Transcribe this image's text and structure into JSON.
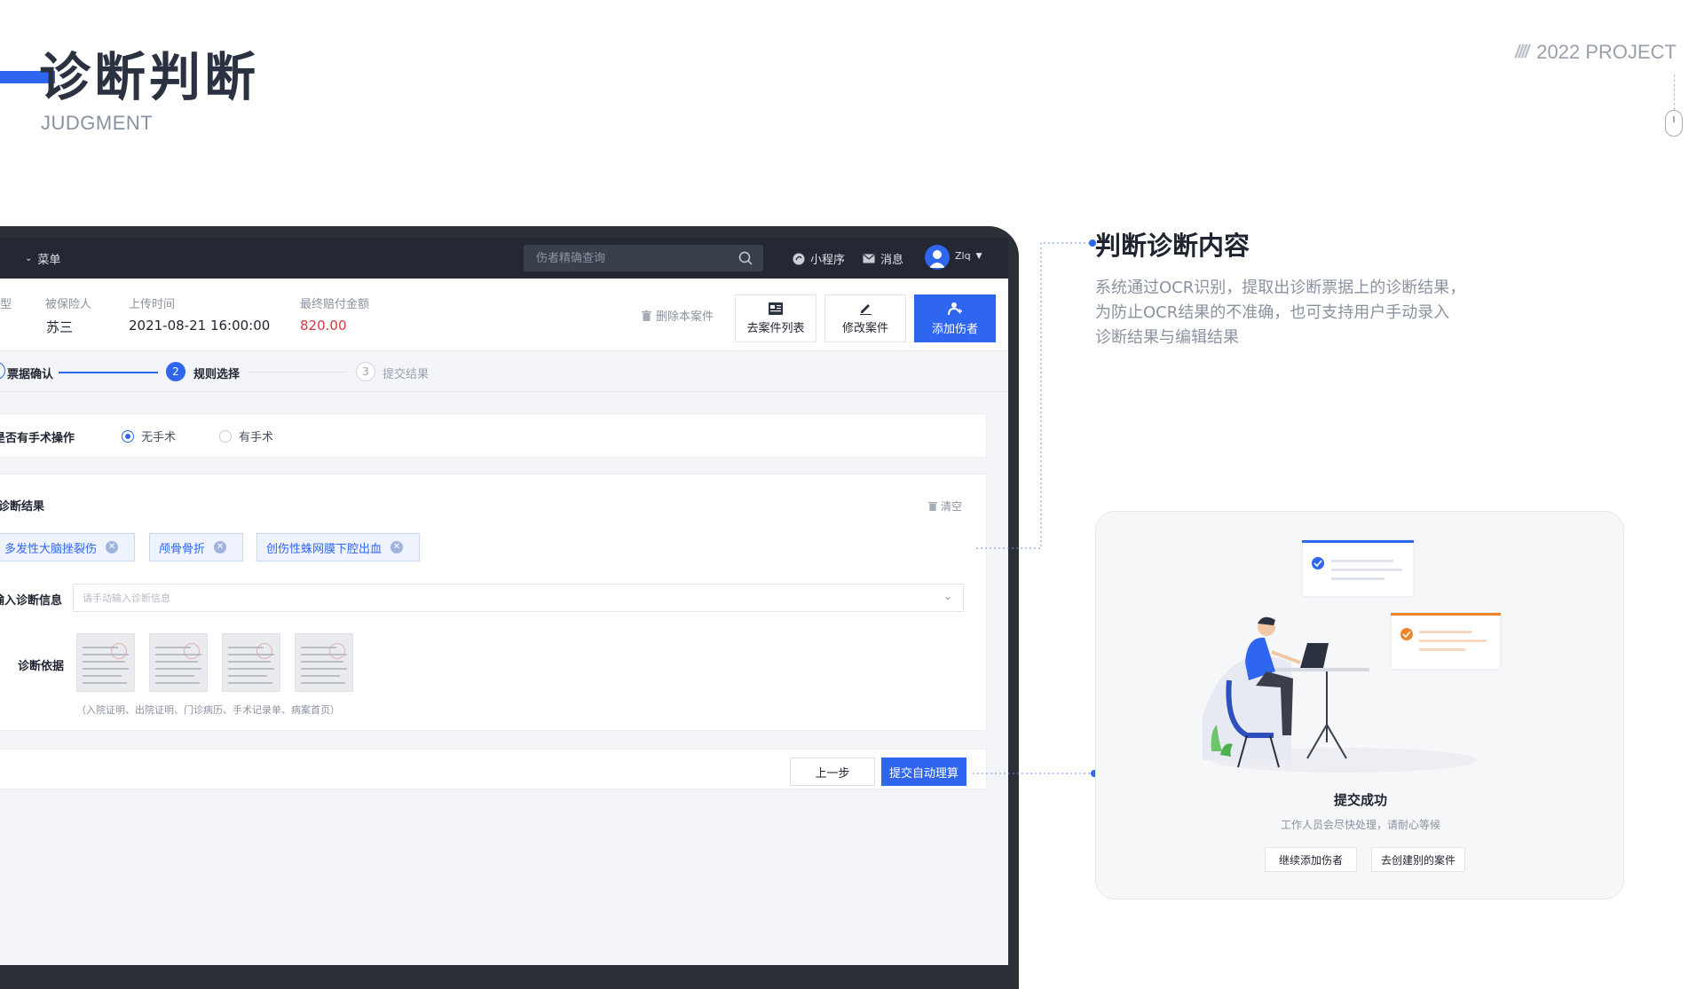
{
  "page": {
    "title": "诊断判断",
    "subtitle": "JUDGMENT",
    "project_label": "2022 PROJECT",
    "accent_color": "#2f66f0"
  },
  "app": {
    "topbar": {
      "menu_label": "菜单",
      "search_placeholder": "伤者精确查询",
      "mini_program_label": "小程序",
      "messages_label": "消息",
      "user_name": "Zlq"
    },
    "summary": {
      "col_type_label": "型",
      "insured_label": "被保险人",
      "insured_value": "苏三",
      "upload_time_label": "上传时间",
      "upload_time_value": "2021-08-21 16:00:00",
      "final_amount_label": "最终赔付金额",
      "final_amount_value": "820.00",
      "delete_case_label": "删除本案件",
      "actions": {
        "case_list": "去案件列表",
        "edit_case": "修改案件",
        "add_injured": "添加伤者"
      }
    },
    "steps": {
      "step1_label": "票据确认",
      "step2_num": "2",
      "step2_label": "规则选择",
      "step3_num": "3",
      "step3_label": "提交结果"
    },
    "surgery": {
      "label": "是否有手术操作",
      "option_no": "无手术",
      "option_yes": "有手术",
      "selected": "无手术"
    },
    "diagnosis": {
      "label": "诊断结果",
      "clear_label": "清空",
      "tags": [
        "多发性大脑挫裂伤",
        "颅骨骨折",
        "创伤性蛛网膜下腔出血"
      ],
      "manual_label": "输入诊断信息",
      "manual_placeholder": "请手动输入诊断信息",
      "basis_label": "诊断依据",
      "basis_note": "（入院证明、出院证明、门诊病历、手术记录单、病案首页）"
    },
    "footer": {
      "prev_label": "上一步",
      "submit_label": "提交自动理算"
    }
  },
  "annotation": {
    "title": "判断诊断内容",
    "lines": [
      "系统通过OCR识别，提取出诊断票据上的诊断结果，",
      "为防止OCR结果的不准确，也可支持用户手动录入",
      "诊断结果与编辑结果"
    ]
  },
  "success": {
    "title": "提交成功",
    "desc": "工作人员会尽快处理，请耐心等候",
    "continue_label": "继续添加伤者",
    "create_other_label": "去创建别的案件"
  }
}
